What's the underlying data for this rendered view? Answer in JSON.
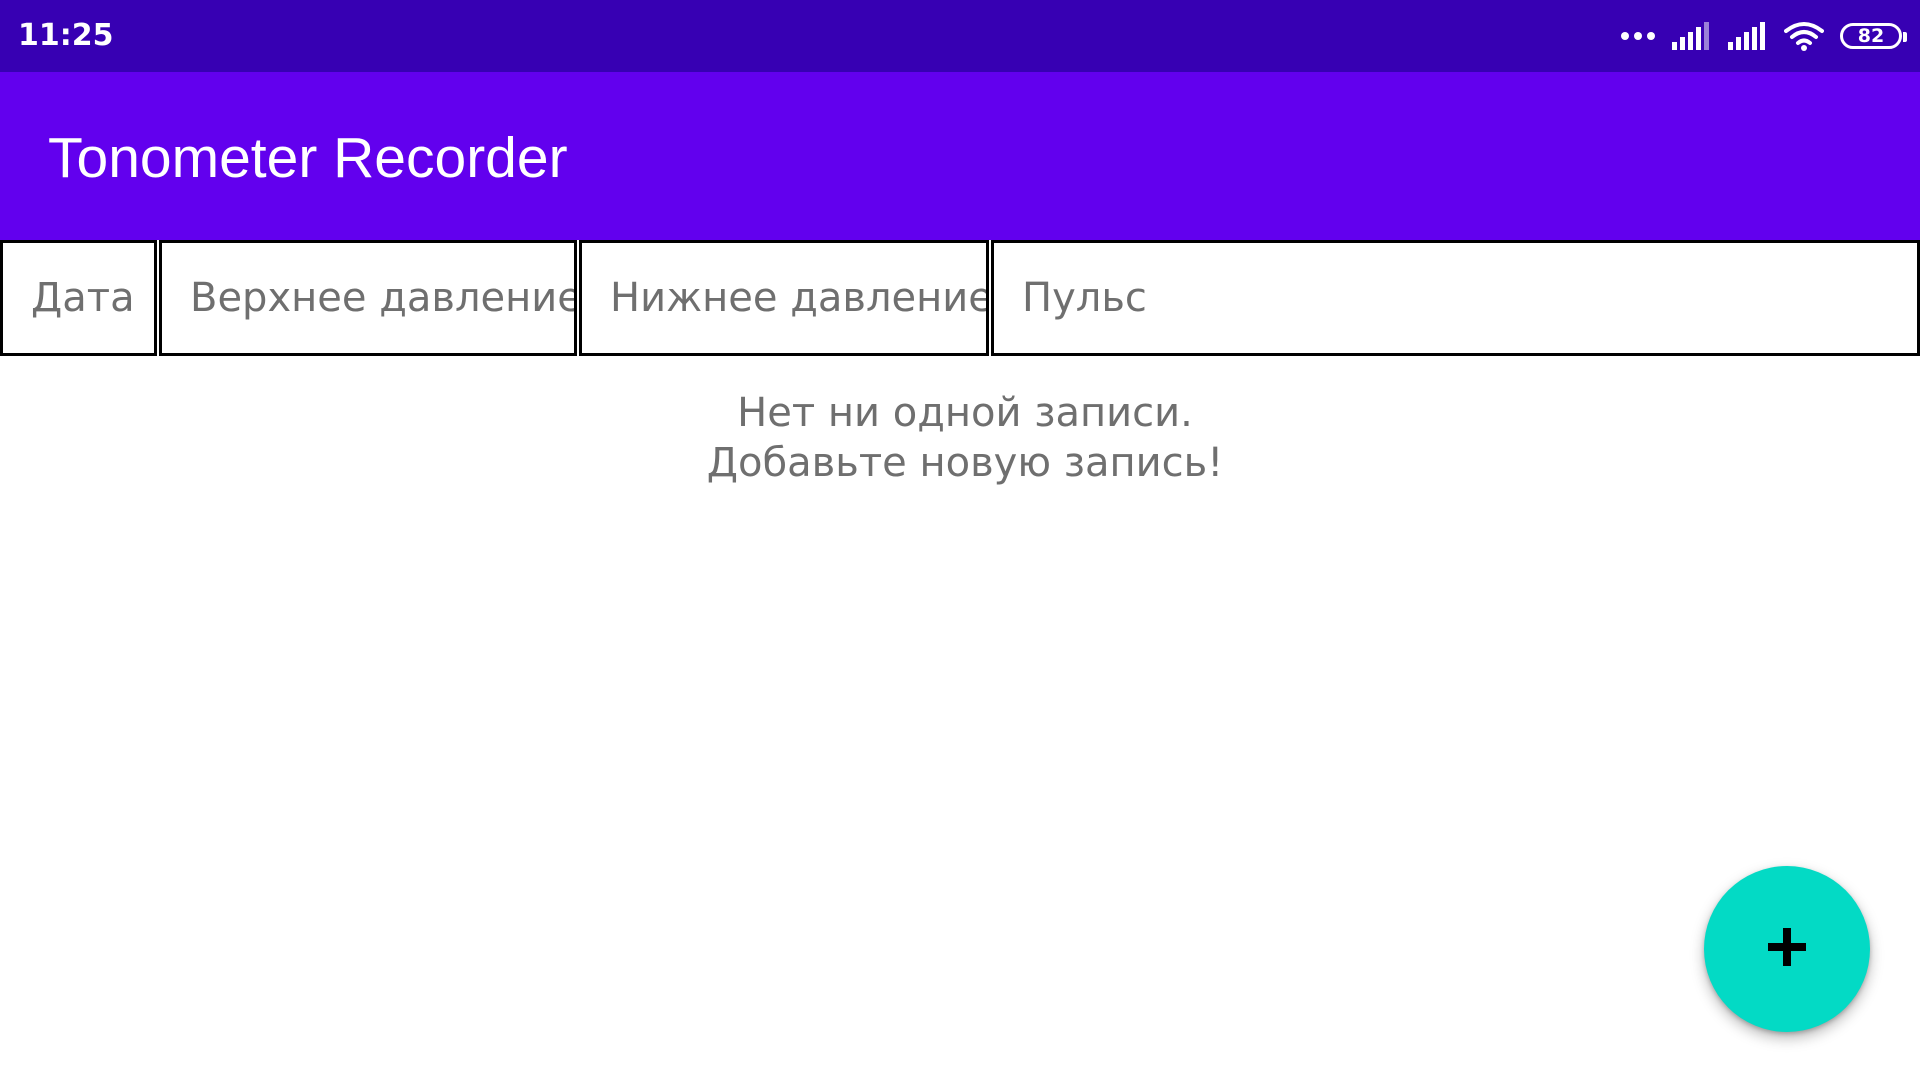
{
  "status_bar": {
    "time": "11:25",
    "battery_level": "82",
    "icons": [
      "more-dots-icon",
      "signal-icon",
      "signal-icon",
      "wifi-icon",
      "battery-icon"
    ]
  },
  "app_bar": {
    "title": "Tonometer Recorder",
    "color": "#6200ee"
  },
  "table": {
    "columns": [
      {
        "label": "Дата"
      },
      {
        "label": "Верхнее давление"
      },
      {
        "label": "Нижнее давление"
      },
      {
        "label": "Пульс"
      }
    ],
    "rows": []
  },
  "empty_state": {
    "line1": "Нет ни одной записи.",
    "line2": "Добавьте новую запись!"
  },
  "fab": {
    "icon": "plus-icon",
    "color": "#03dac5"
  },
  "colors": {
    "status_bar": "#3700b3",
    "app_bar": "#6200ee",
    "fab": "#03dac5",
    "secondary_text": "#6f6f6f"
  }
}
